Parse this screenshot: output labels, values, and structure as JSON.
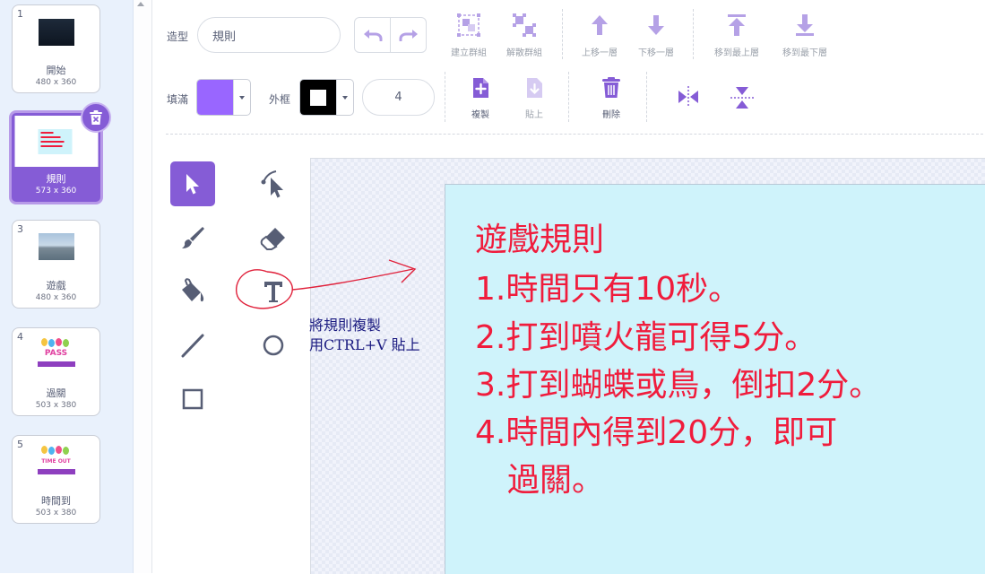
{
  "costumes": [
    {
      "number": "1",
      "name": "開始",
      "size": "480 x 360",
      "thumb": "dark"
    },
    {
      "number": "2",
      "name": "規則",
      "size": "573 x 360",
      "thumb": "rules",
      "selected": true
    },
    {
      "number": "3",
      "name": "遊戲",
      "size": "480 x 360",
      "thumb": "city"
    },
    {
      "number": "4",
      "name": "過關",
      "size": "503 x 380",
      "thumb": "pass",
      "thumb_text": "PASS"
    },
    {
      "number": "5",
      "name": "時間到",
      "size": "503 x 380",
      "thumb": "timeout",
      "thumb_text": "TIME OUT"
    }
  ],
  "toolbar": {
    "costume_label": "造型",
    "costume_name": "規則",
    "group_label": "建立群組",
    "ungroup_label": "解散群組",
    "forward_label": "上移一層",
    "backward_label": "下移一層",
    "front_label": "移到最上層",
    "back_label": "移到最下層",
    "fill_label": "填滿",
    "fill_color": "#9966ff",
    "outline_label": "外框",
    "outline_color": "#000000",
    "outline_width": "4",
    "copy_label": "複製",
    "paste_label": "貼上",
    "delete_label": "刪除"
  },
  "canvas": {
    "rules": [
      "遊戲規則",
      "1.時間只有10秒。",
      "2.打到噴火龍可得5分。",
      "3.打到蝴蝶或鳥，倒扣2分。",
      "4.時間內得到20分，即可",
      "過關。"
    ],
    "text_color": "#f01c3c",
    "box_color": "#cff3fb"
  },
  "annotation": {
    "line1": "將規則複製",
    "line2": "用CTRL+V 貼上"
  },
  "colors": {
    "accent": "#855cd6",
    "icon_purple": "#855cd6",
    "icon_disabled": "#b5a1e6",
    "annotation_red": "#e0203a"
  }
}
